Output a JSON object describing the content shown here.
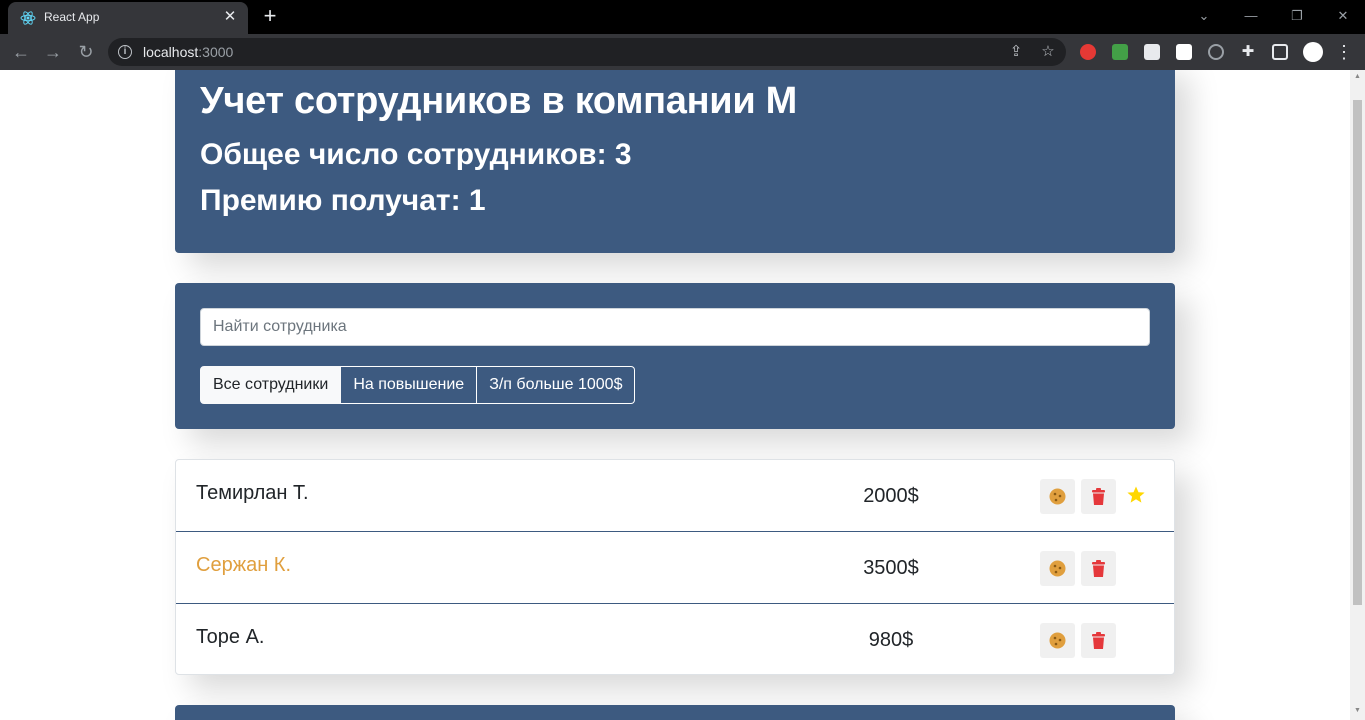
{
  "browser": {
    "tab_title": "React App",
    "url_host": "localhost",
    "url_port": ":3000"
  },
  "app": {
    "title": "Учет сотрудников в компании M",
    "total_label": "Общее число сотрудников: 3",
    "bonus_label": "Премию получат: 1"
  },
  "search": {
    "placeholder": "Найти сотрудника"
  },
  "filters": [
    {
      "label": "Все сотрудники",
      "active": true
    },
    {
      "label": "На повышение",
      "active": false
    },
    {
      "label": "З/п больше 1000$",
      "active": false
    }
  ],
  "employees": [
    {
      "name": "Темирлан Т.",
      "salary": "2000$",
      "increase": false,
      "like": true
    },
    {
      "name": "Сержан К.",
      "salary": "3500$",
      "increase": true,
      "like": false
    },
    {
      "name": "Торе А.",
      "salary": "980$",
      "increase": false,
      "like": false
    }
  ],
  "colors": {
    "panel": "#3d5a80",
    "increase": "#e09f3e",
    "trash": "#e5383b",
    "star": "#ffd700"
  },
  "icons": [
    "react-icon",
    "info-icon",
    "share-icon",
    "bookmark-star-icon",
    "puzzle-icon",
    "sidebar-icon",
    "profile-icon",
    "menu-dots-icon",
    "cookie-icon",
    "trash-icon",
    "star-icon"
  ]
}
